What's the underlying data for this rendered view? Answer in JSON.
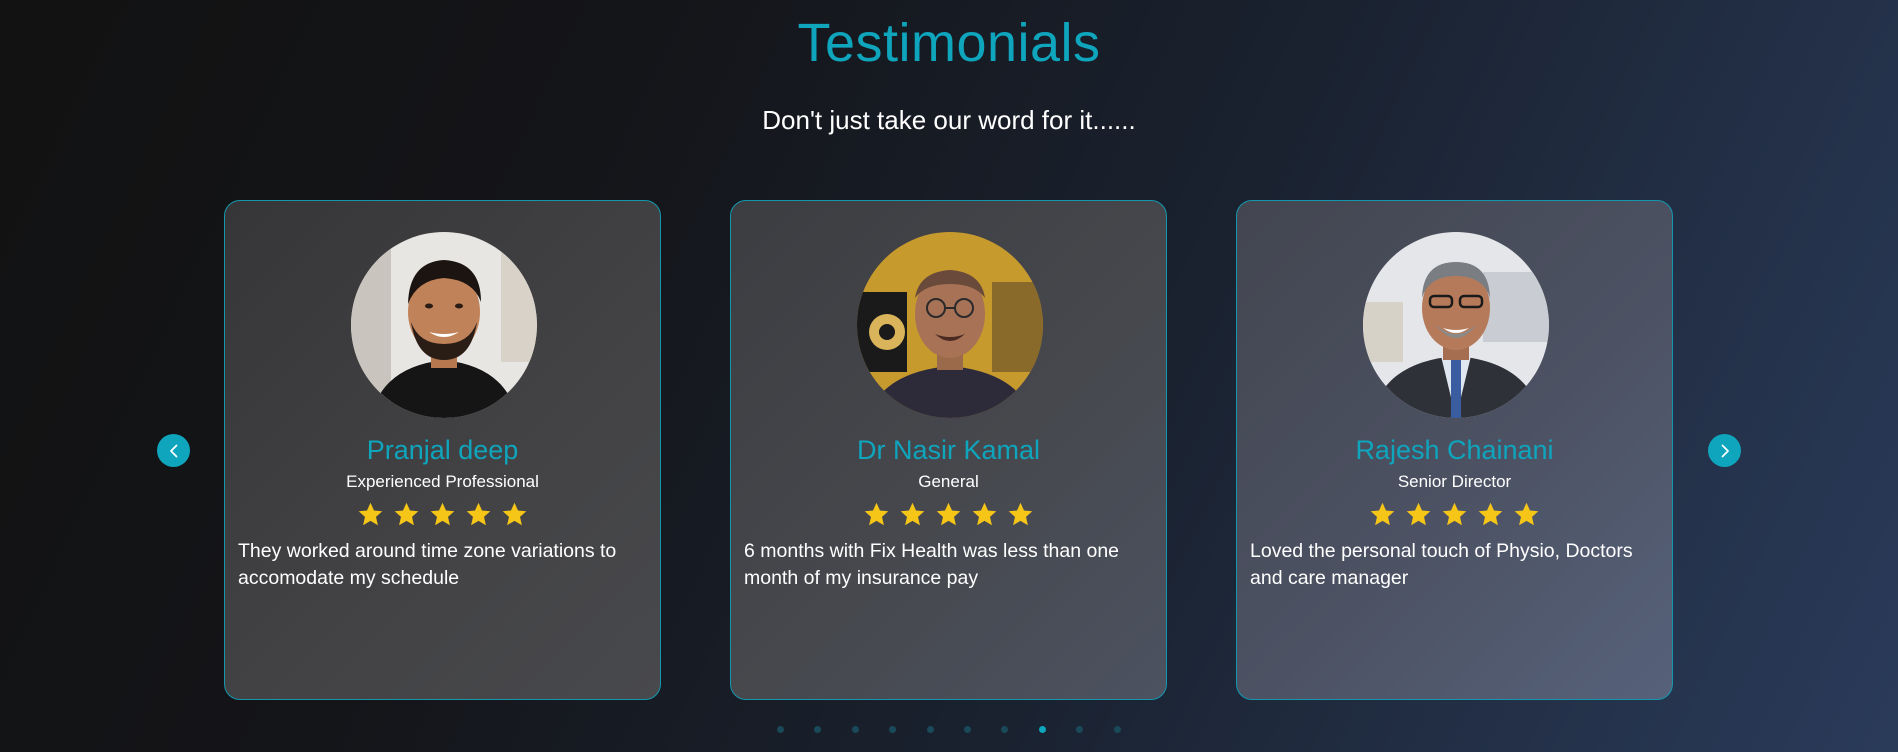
{
  "header": {
    "title": "Testimonials",
    "subtitle": "Don't just take our word for it......"
  },
  "carousel": {
    "prev_icon": "chevron-left-icon",
    "next_icon": "chevron-right-icon",
    "accent_color": "#0ea5bd",
    "star_color": "#f5c518",
    "page_count": 10,
    "active_page": 8
  },
  "testimonials": [
    {
      "name": "Pranjal deep",
      "role": "Experienced Professional",
      "rating": 5,
      "quote": "They worked around time zone variations to accomodate my schedule"
    },
    {
      "name": "Dr Nasir Kamal",
      "role": "General",
      "rating": 5,
      "quote": "6 months with Fix Health was less than one month of my insurance pay"
    },
    {
      "name": "Rajesh Chainani",
      "role": "Senior Director",
      "rating": 5,
      "quote": "Loved the personal touch of Physio, Doctors and care manager"
    }
  ]
}
